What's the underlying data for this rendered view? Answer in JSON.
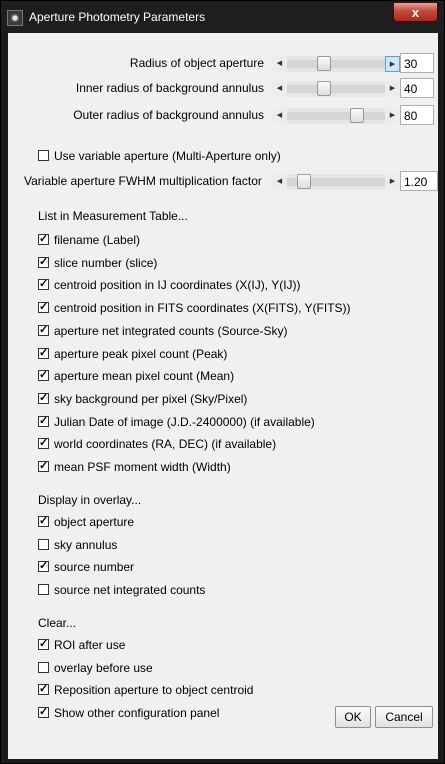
{
  "window": {
    "title": "Aperture Photometry Parameters",
    "close_label": "x"
  },
  "sliders": {
    "object_aperture": {
      "label": "Radius of object aperture",
      "value": "30",
      "position_fraction": 0.36
    },
    "inner_annulus": {
      "label": "Inner radius of background annulus",
      "value": "40",
      "position_fraction": 0.36
    },
    "outer_annulus": {
      "label": "Outer radius of background annulus",
      "value": "80",
      "position_fraction": 0.75
    },
    "fwhm_factor": {
      "label": "Variable aperture FWHM multiplication factor",
      "value": "1.20",
      "position_fraction": 0.12
    }
  },
  "variable_aperture": {
    "label": "Use variable aperture (Multi-Aperture only)",
    "checked": false
  },
  "measurement_table": {
    "header": "List in Measurement Table...",
    "items": [
      {
        "label": "filename (Label)",
        "checked": true
      },
      {
        "label": "slice number (slice)",
        "checked": true
      },
      {
        "label": "centroid position in IJ coordinates (X(IJ), Y(IJ))",
        "checked": true
      },
      {
        "label": "centroid position in FITS coordinates (X(FITS), Y(FITS))",
        "checked": true
      },
      {
        "label": "aperture net integrated counts (Source-Sky)",
        "checked": true
      },
      {
        "label": "aperture peak pixel count (Peak)",
        "checked": true
      },
      {
        "label": "aperture mean pixel count (Mean)",
        "checked": true
      },
      {
        "label": "sky background per pixel (Sky/Pixel)",
        "checked": true
      },
      {
        "label": "Julian Date of image (J.D.-2400000) (if available)",
        "checked": true
      },
      {
        "label": "world coordinates (RA, DEC) (if available)",
        "checked": true
      },
      {
        "label": "mean PSF moment width (Width)",
        "checked": true
      }
    ]
  },
  "overlay": {
    "header": "Display in overlay...",
    "items": [
      {
        "label": "object aperture",
        "checked": true
      },
      {
        "label": "sky annulus",
        "checked": false
      },
      {
        "label": "source number",
        "checked": true
      },
      {
        "label": "source net integrated counts",
        "checked": false
      }
    ]
  },
  "clear": {
    "header": "Clear...",
    "items": [
      {
        "label": "ROI after use",
        "checked": true
      },
      {
        "label": "overlay before use",
        "checked": false
      },
      {
        "label": "Reposition aperture to object centroid",
        "checked": true
      },
      {
        "label": "Show other configuration panel",
        "checked": true
      }
    ]
  },
  "buttons": {
    "ok": "OK",
    "cancel": "Cancel"
  }
}
